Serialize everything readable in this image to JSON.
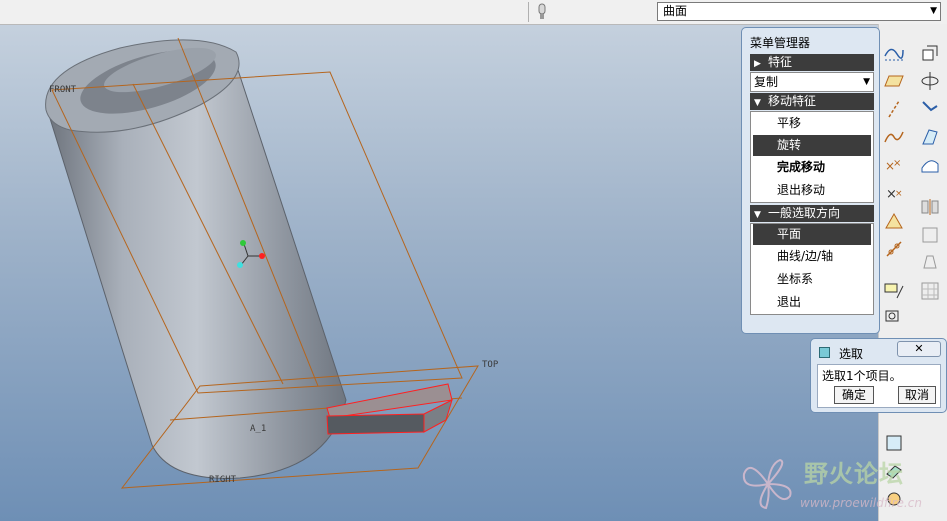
{
  "topbar": {
    "combo_value": "曲面"
  },
  "viewport": {
    "datum_labels": {
      "front": "FRONT",
      "top": "TOP",
      "right": "RIGHT",
      "axis": "A_1"
    }
  },
  "menu_manager": {
    "title": "菜单管理器",
    "features_header": "特征",
    "copy_select": "复制",
    "move_header": "移动特征",
    "move_items": [
      "平移",
      "旋转",
      "完成移动",
      "退出移动"
    ],
    "direction_header": "一般选取方向",
    "direction_items": [
      "平面",
      "曲线/边/轴",
      "坐标系",
      "退出"
    ]
  },
  "select_dialog": {
    "title": "选取",
    "prompt": "选取1个项目。",
    "ok": "确定",
    "cancel": "取消"
  },
  "watermark": {
    "title": "野火论坛",
    "url": "www.proewildfire.cn"
  },
  "colors": {
    "panel_bg": "#dde7f2",
    "header_bg": "#3c3c3c",
    "datum": "#b5651d",
    "highlight": "#ff0000"
  }
}
